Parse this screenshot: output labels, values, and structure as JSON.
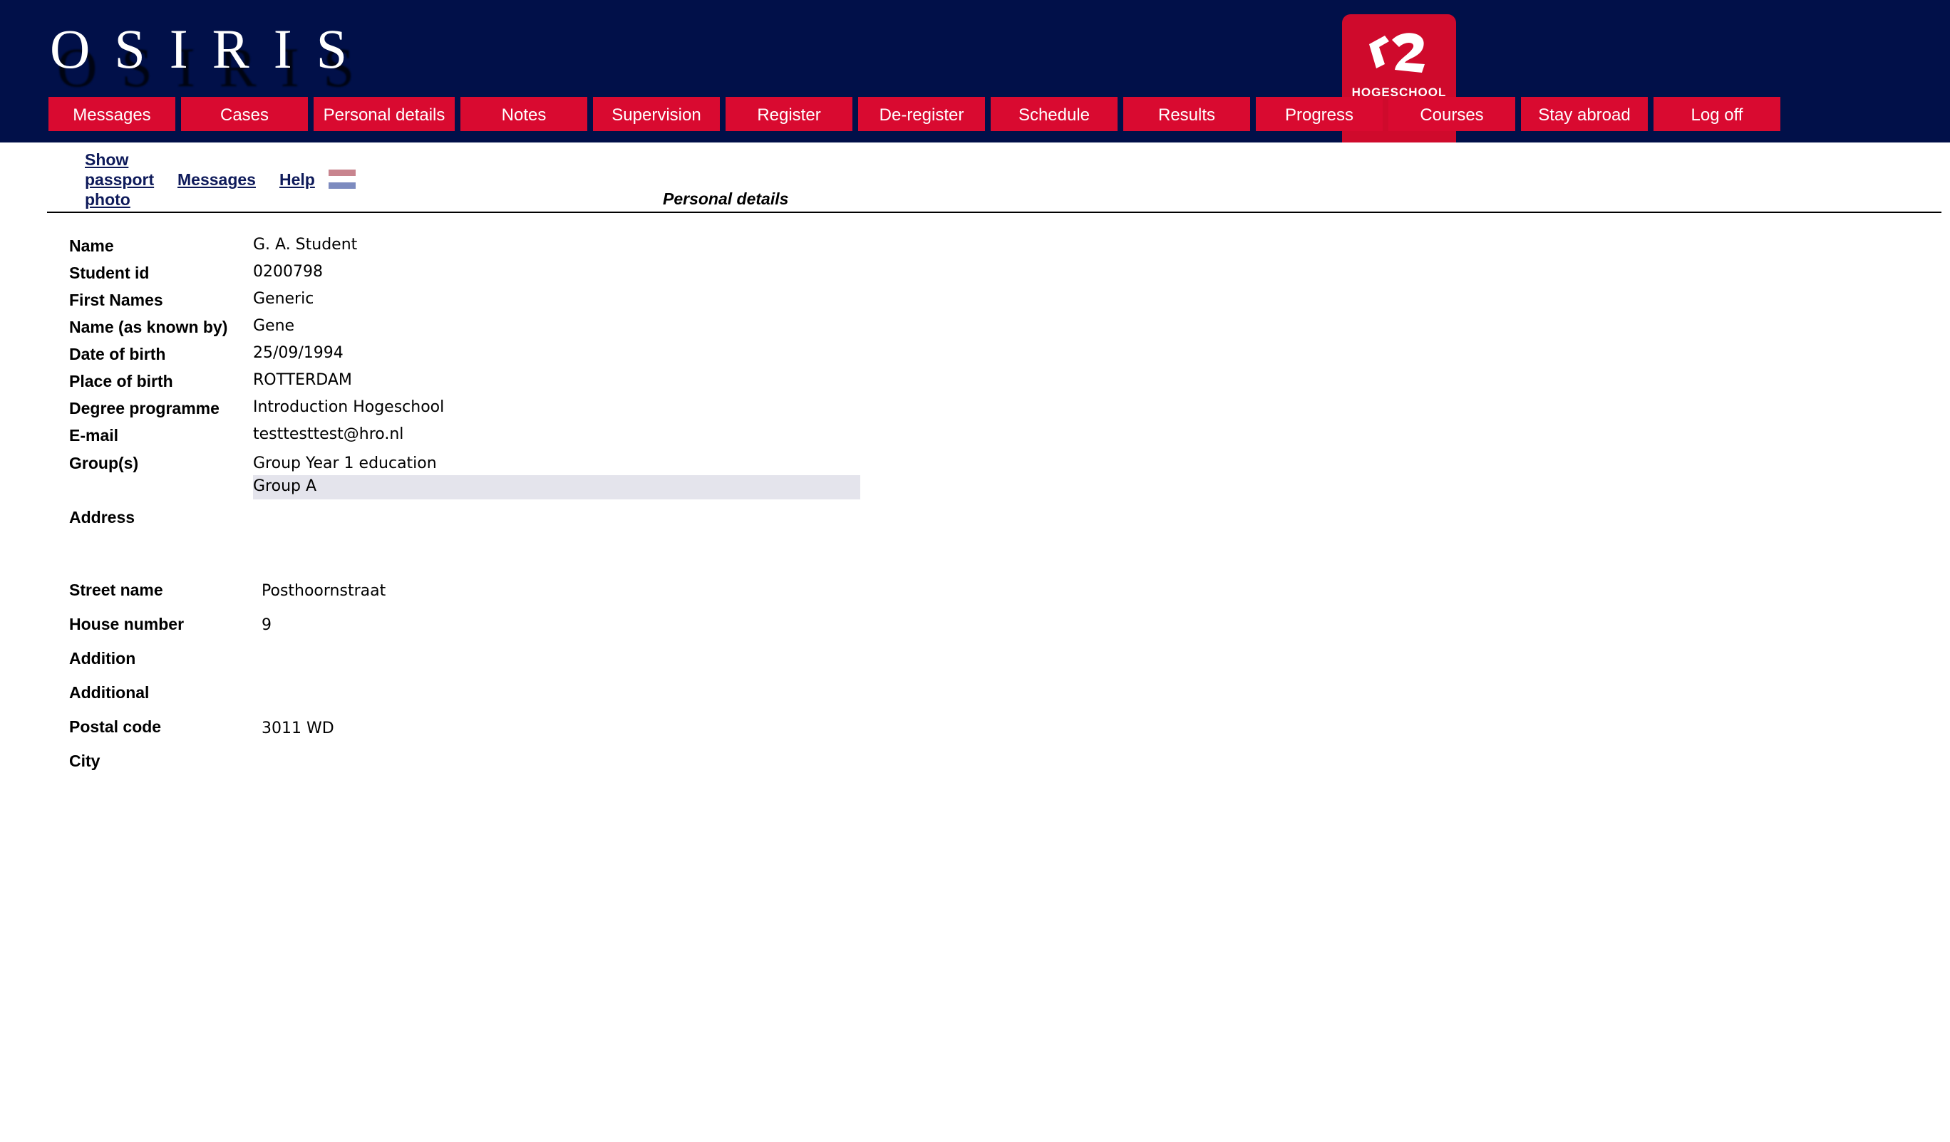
{
  "header": {
    "logo_text": "OSIRIS",
    "school_badge": {
      "name": "HOGESCHOOL",
      "sub": "1"
    },
    "colors": {
      "header_bg": "#011049",
      "nav_bg": "#d90a30",
      "badge_bg": "#cf0a2c"
    },
    "nav": [
      "Messages",
      "Cases",
      "Personal details",
      "Notes",
      "Supervision",
      "Register",
      "De-register",
      "Schedule",
      "Results",
      "Progress",
      "Courses",
      "Stay abroad",
      "Log off"
    ]
  },
  "sublinks": {
    "show_passport_photo": [
      "Show",
      "passport",
      "photo"
    ],
    "messages": "Messages",
    "help": "Help",
    "language_flag_icon": "netherlands-flag-icon"
  },
  "page_title": "Personal details",
  "fields": [
    {
      "label": "Name",
      "value": "G. A. Student"
    },
    {
      "label": "Student id",
      "value": "0200798"
    },
    {
      "label": "First Names",
      "value": "Generic"
    },
    {
      "label": "Name (as known by)",
      "value": "Gene"
    },
    {
      "label": "Date of birth",
      "value": "25/09/1994"
    },
    {
      "label": "Place of birth",
      "value": "ROTTERDAM"
    },
    {
      "label": "Degree programme",
      "value": "Introduction Hogeschool"
    },
    {
      "label": "E-mail",
      "value": "testtesttest@hro.nl"
    },
    {
      "label": "Group(s)",
      "value": "Group Year 1 education",
      "value2": "Group A"
    }
  ],
  "address": {
    "heading": "Address",
    "fields": [
      {
        "label": "Street name",
        "value": "Posthoornstraat"
      },
      {
        "label": "House number",
        "value": "9"
      },
      {
        "label": "Addition",
        "value": ""
      },
      {
        "label": "Additional",
        "value": ""
      },
      {
        "label": "Postal code",
        "value": "3011 WD"
      },
      {
        "label": "City",
        "value": ""
      }
    ]
  }
}
